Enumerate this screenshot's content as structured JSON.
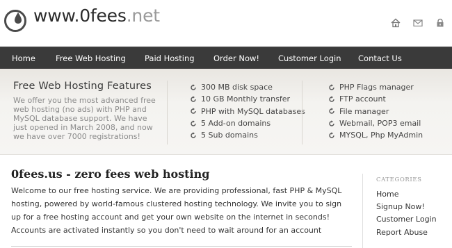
{
  "header": {
    "site_name": "www.0fees",
    "site_tld": ".net",
    "icons": [
      "home-icon",
      "mail-icon",
      "lock-icon"
    ]
  },
  "nav": {
    "items": [
      {
        "label": "Home"
      },
      {
        "label": "Free Web Hosting"
      },
      {
        "label": "Paid Hosting"
      },
      {
        "label": "Order Now!"
      },
      {
        "label": "Customer Login"
      },
      {
        "label": "Contact Us"
      }
    ]
  },
  "features": {
    "title": "Free Web Hosting Features",
    "description": "We offer you the most advanced free web hosting (no ads) with PHP and MySQL database support. We have just opened in March 2008, and now we have over 7000 registrations!",
    "list_a": [
      "300 MB disk space",
      "10 GB Monthly transfer",
      "PHP with MySQL databases",
      "5 Add-on domains",
      "5 Sub domains"
    ],
    "list_b": [
      "PHP Flags manager",
      "FTP account",
      "File manager",
      "Webmail, POP3 email",
      "MYSQL, Php MyAdmin"
    ]
  },
  "main": {
    "title": "0fees.us - zero fees web hosting",
    "text": "Welcome to our free hosting service. We are providing professional, fast PHP & MySQL hosting, powered by world-famous clustered hosting technology. We invite you to sign up for a free hosting account and get your own website on the internet in seconds! Accounts are activated instantly so you don't need to wait around for an account"
  },
  "sidebar": {
    "heading": "CATEGORIES",
    "items": [
      "Home",
      "Signup Now!",
      "Customer Login",
      "Report Abuse"
    ]
  },
  "colors": {
    "nav_bg": "#3a3a3a",
    "band_bg": "#f4f3f0",
    "logo_gray": "#4a4a4a"
  }
}
